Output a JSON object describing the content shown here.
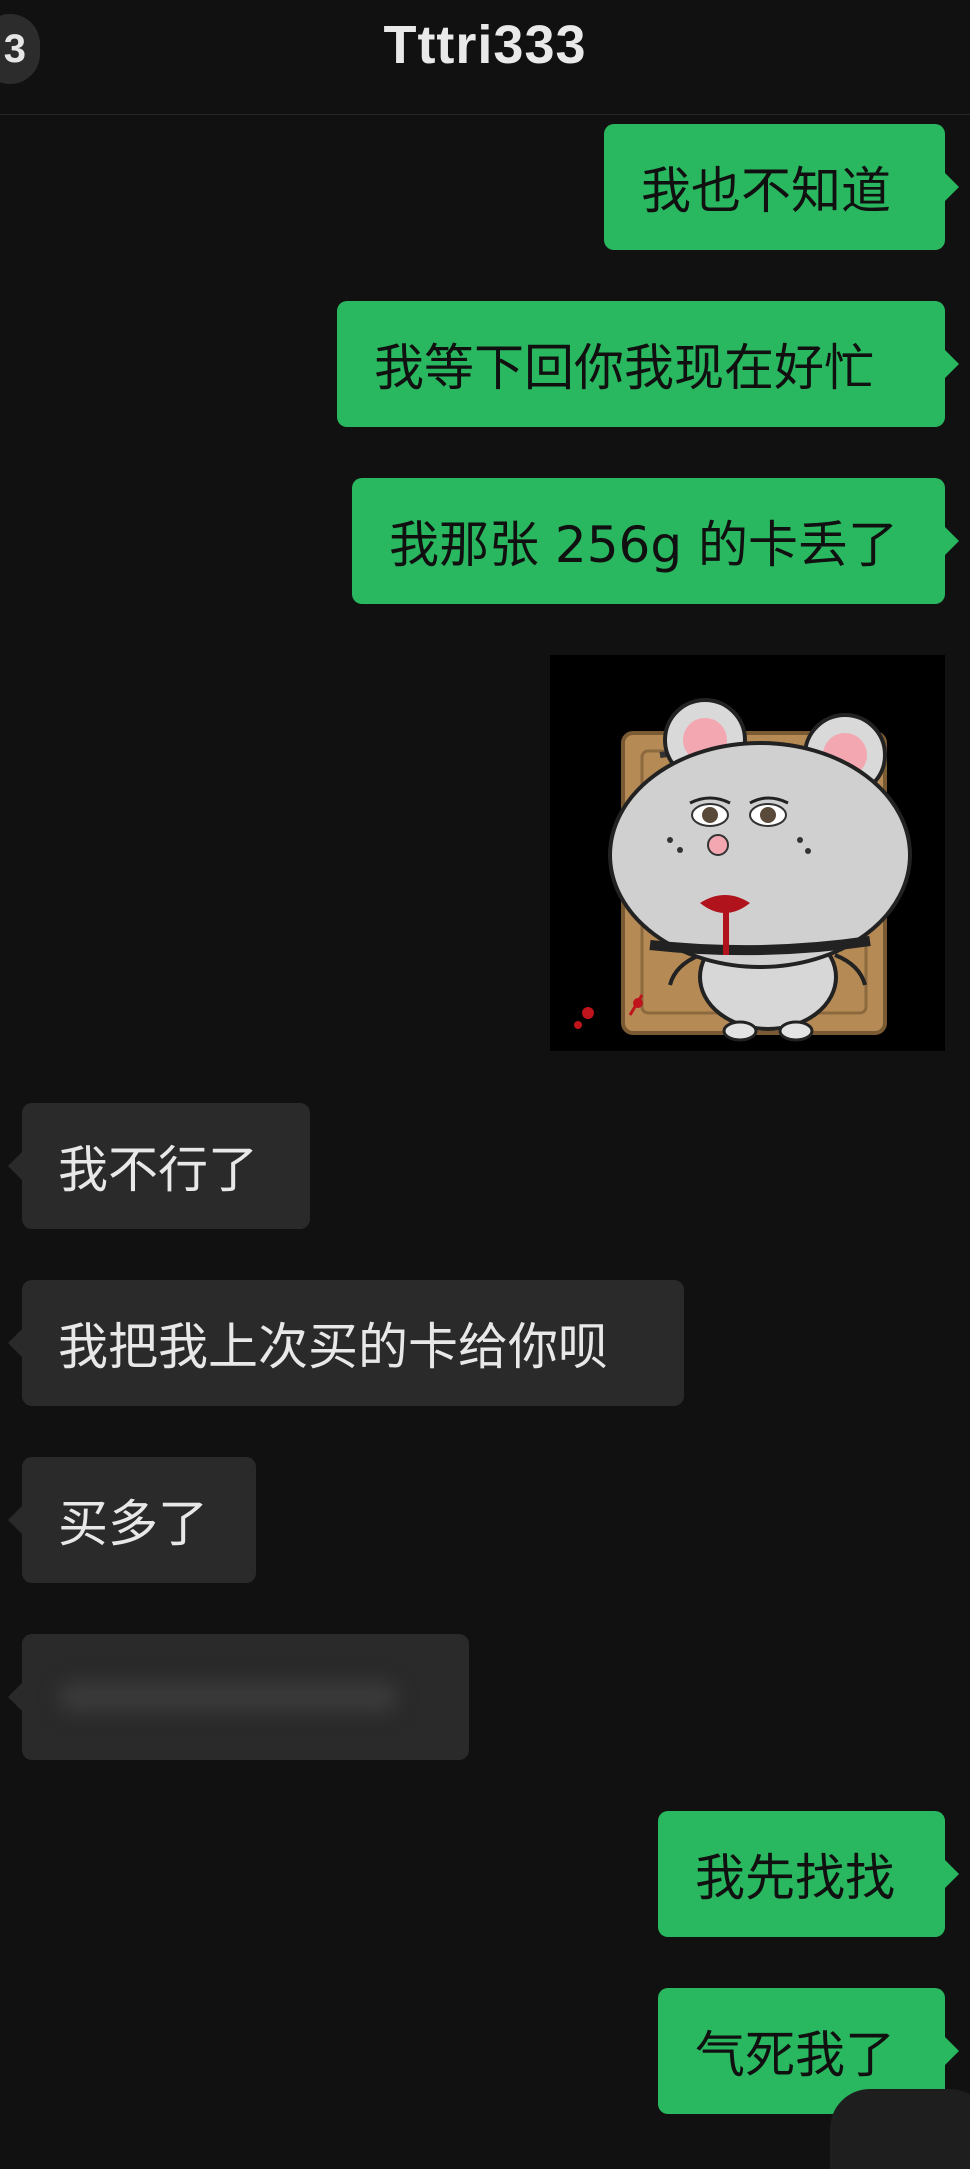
{
  "header": {
    "back_badge": "3",
    "title": "Tttri333"
  },
  "messages": [
    {
      "side": "out",
      "text": "我也不知道"
    },
    {
      "side": "out",
      "text": "我等下回你我现在好忙"
    },
    {
      "side": "out",
      "text": "我那张 256g 的卡丢了"
    },
    {
      "side": "out",
      "type": "sticker",
      "sticker": "bleeding-mouse-sticker"
    },
    {
      "side": "in",
      "text": "我不行了"
    },
    {
      "side": "in",
      "text": "我把我上次买的卡给你呗"
    },
    {
      "side": "in",
      "text": "买多了"
    },
    {
      "side": "in",
      "text": "",
      "blurred": true
    },
    {
      "side": "out",
      "text": "我先找找"
    },
    {
      "side": "out",
      "text": "气死我了"
    }
  ],
  "colors": {
    "background": "#111111",
    "outgoing_bubble": "#29b75f",
    "incoming_bubble": "#2a2a2a"
  }
}
